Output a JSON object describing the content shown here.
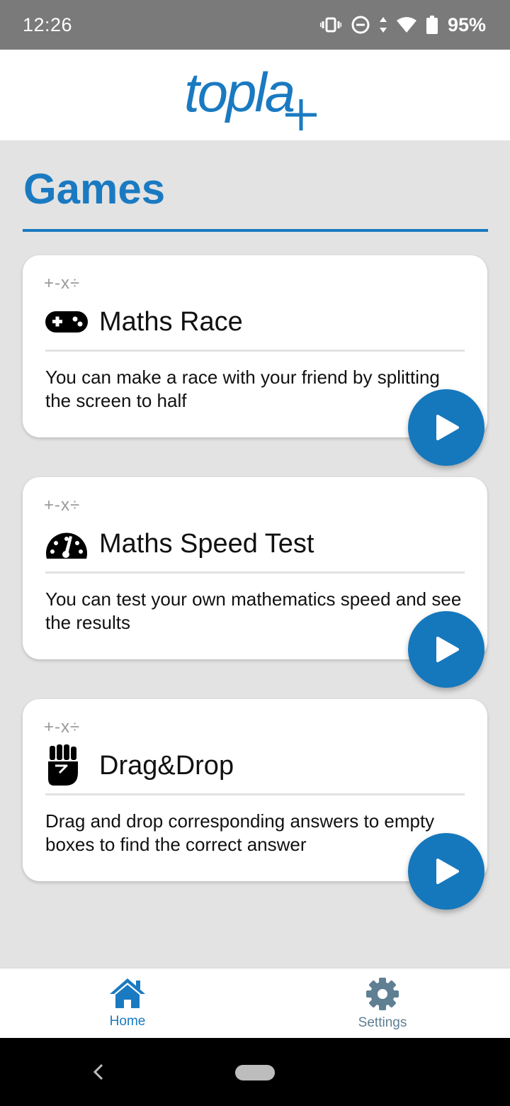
{
  "status_bar": {
    "time": "12:26",
    "battery": "95%",
    "icons": [
      "vibrate-icon",
      "dnd-icon",
      "data-arrows-icon",
      "wifi-icon",
      "battery-icon"
    ]
  },
  "header": {
    "logo_text": "topla",
    "logo_accent": "+"
  },
  "page": {
    "title": "Games"
  },
  "games": [
    {
      "ops": "+-x÷",
      "icon": "gamepad-icon",
      "title": "Maths Race",
      "description": "You can make a race with your friend by splitting the screen to half"
    },
    {
      "ops": "+-x÷",
      "icon": "speedometer-icon",
      "title": "Maths Speed Test",
      "description": "You can test your own mathematics speed and see the results"
    },
    {
      "ops": "+-x÷",
      "icon": "fist-icon",
      "title": "Drag&Drop",
      "description": "Drag and drop corresponding answers to empty boxes to find the correct answer"
    }
  ],
  "bottom_nav": {
    "home_label": "Home",
    "settings_label": "Settings"
  },
  "colors": {
    "accent": "#1a7ac1",
    "play_button": "#1578bd",
    "background": "#e3e3e3",
    "status_bar": "#7a7a7a"
  }
}
